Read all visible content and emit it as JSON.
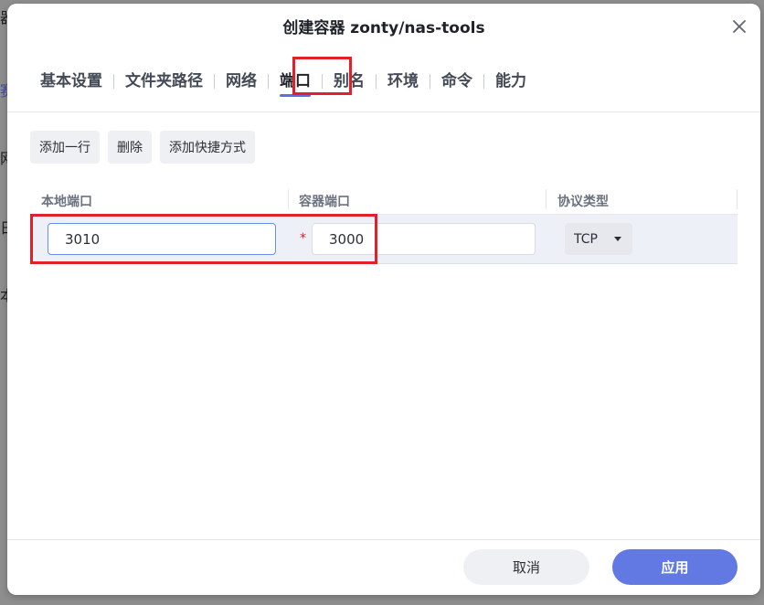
{
  "dialog": {
    "title": "创建容器 zonty/nas-tools",
    "close_icon": "close-icon"
  },
  "tabs": [
    {
      "label": "基本设置",
      "active": false
    },
    {
      "label": "文件夹路径",
      "active": false
    },
    {
      "label": "网络",
      "active": false
    },
    {
      "label": "端口",
      "active": true
    },
    {
      "label": "别名",
      "active": false
    },
    {
      "label": "环境",
      "active": false
    },
    {
      "label": "命令",
      "active": false
    },
    {
      "label": "能力",
      "active": false
    }
  ],
  "toolbar": {
    "add_row": "添加一行",
    "delete": "删除",
    "add_shortcut": "添加快捷方式"
  },
  "table": {
    "headers": {
      "local_port": "本地端口",
      "container_port": "容器端口",
      "protocol": "协议类型"
    },
    "rows": [
      {
        "local_port": "3010",
        "required_mark": "*",
        "container_port": "3000",
        "protocol": "TCP"
      }
    ]
  },
  "footer": {
    "cancel": "取消",
    "apply": "应用"
  },
  "colors": {
    "accent": "#6279e4",
    "highlight": "#e0202a"
  }
}
